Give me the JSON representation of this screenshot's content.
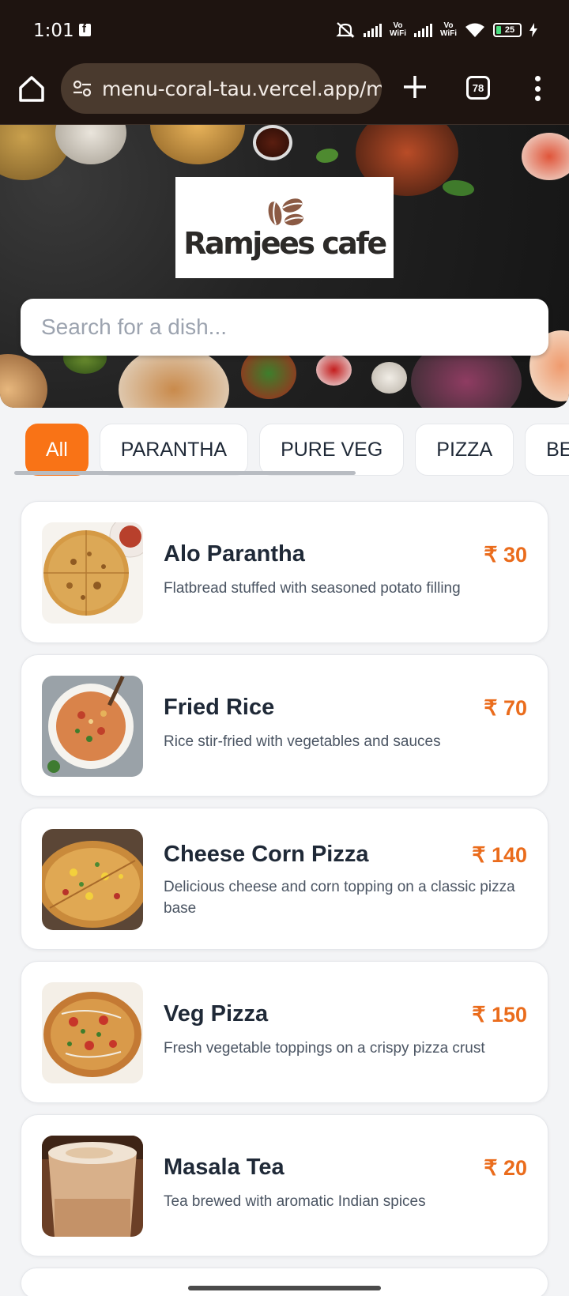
{
  "status_bar": {
    "time": "1:01",
    "battery": "25",
    "vowifi": "Vo\nWiFi"
  },
  "browser": {
    "url": "menu-coral-tau.vercel.app/m",
    "tab_count": "78"
  },
  "header": {
    "logo_text": "Ramjees cafe"
  },
  "search": {
    "placeholder": "Search for a dish..."
  },
  "categories": [
    {
      "label": "All",
      "active": true
    },
    {
      "label": "PARANTHA",
      "active": false
    },
    {
      "label": "PURE VEG",
      "active": false
    },
    {
      "label": "PIZZA",
      "active": false
    },
    {
      "label": "BE",
      "active": false
    }
  ],
  "menu_items": [
    {
      "name": "Alo Parantha",
      "price": "₹ 30",
      "description": "Flatbread stuffed with seasoned potato filling",
      "image": "parantha"
    },
    {
      "name": "Fried Rice",
      "price": "₹ 70",
      "description": "Rice stir-fried with vegetables and sauces",
      "image": "fried-rice"
    },
    {
      "name": "Cheese Corn Pizza",
      "price": "₹ 140",
      "description": "Delicious cheese and corn topping on a classic pizza base",
      "image": "pizza"
    },
    {
      "name": "Veg Pizza",
      "price": "₹ 150",
      "description": "Fresh vegetable toppings on a crispy pizza crust",
      "image": "pizza"
    },
    {
      "name": "Masala Tea",
      "price": "₹ 20",
      "description": "Tea brewed with aromatic Indian spices",
      "image": "tea"
    }
  ],
  "colors": {
    "accent": "#f97316",
    "price": "#ea6c1c",
    "browser_bg": "#1e1410"
  }
}
